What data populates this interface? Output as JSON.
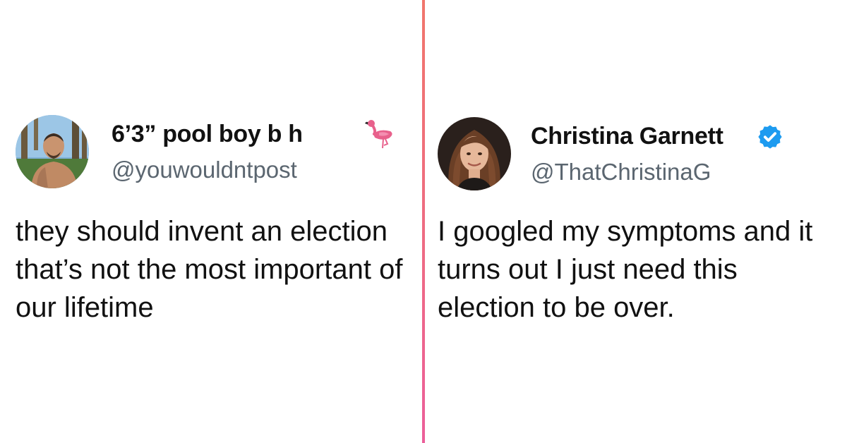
{
  "tweets": [
    {
      "display_name": "6’3” pool boy b   h",
      "emoji_icon": "flamingo-icon",
      "handle": "@youwouldntpost",
      "text": "they should invent an election that’s not the most important of our lifetime"
    },
    {
      "display_name": "Christina Garnett",
      "badge_icon": "verified-badge-icon",
      "handle": "@ThatChristinaG",
      "text": "I googled my symptoms and it turns out I just need this election to be over."
    }
  ],
  "colors": {
    "divider_top": "#f0766c",
    "divider_bottom": "#ec5f9a",
    "handle_gray": "#5b6670",
    "verified_blue": "#1d9bf0",
    "flamingo_pink": "#e8618c"
  }
}
